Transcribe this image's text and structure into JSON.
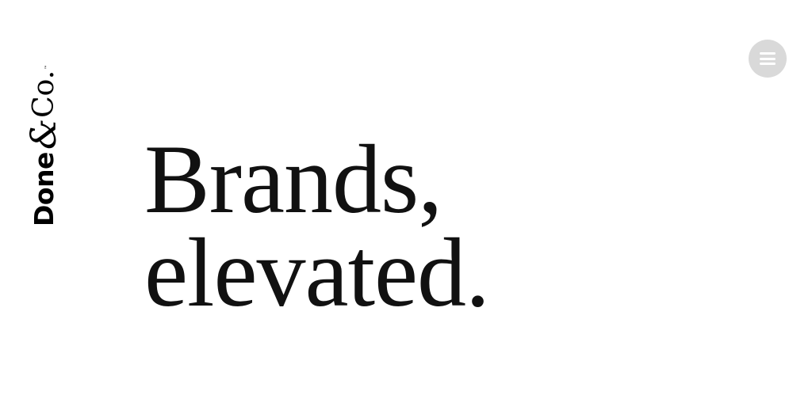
{
  "logo": {
    "done": "Done",
    "amp": "&",
    "co": "Co.",
    "tm": "™"
  },
  "menu": {
    "icon": "hamburger-menu-icon",
    "background": "#d9d9d9"
  },
  "hero": {
    "line1": "Brands,",
    "line2": "elevated."
  }
}
